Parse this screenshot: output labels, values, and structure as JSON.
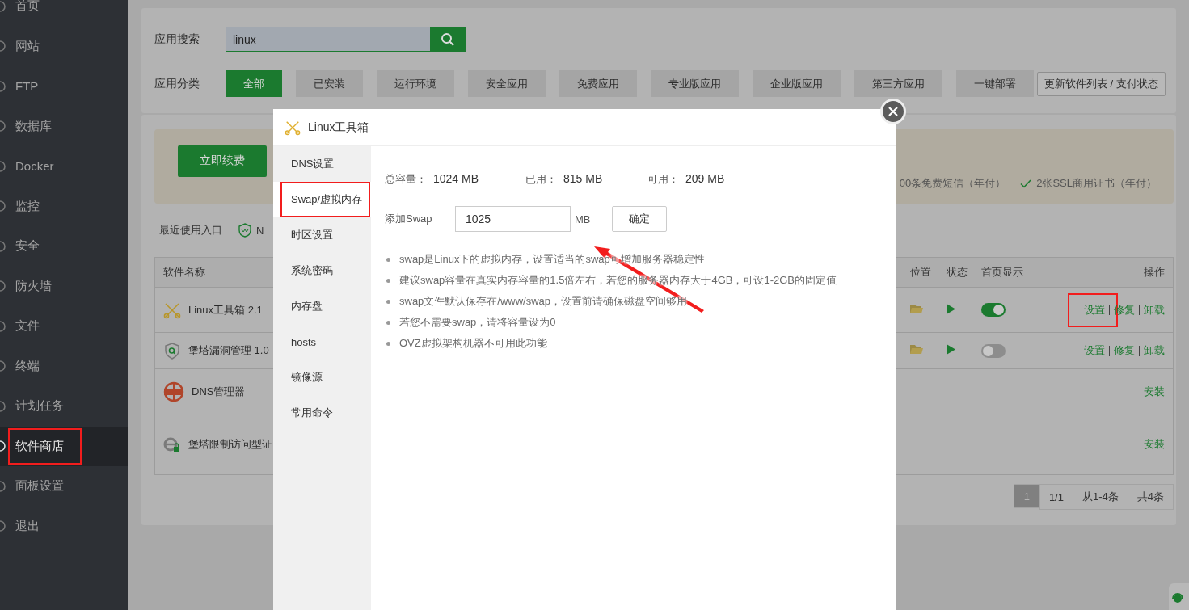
{
  "sidebar": {
    "items": [
      {
        "label": "首页",
        "selected": false,
        "highlighted": false
      },
      {
        "label": "网站",
        "selected": false,
        "highlighted": false
      },
      {
        "label": "FTP",
        "selected": false,
        "highlighted": false
      },
      {
        "label": "数据库",
        "selected": false,
        "highlighted": false
      },
      {
        "label": "Docker",
        "selected": false,
        "highlighted": false
      },
      {
        "label": "监控",
        "selected": false,
        "highlighted": false
      },
      {
        "label": "安全",
        "selected": false,
        "highlighted": false
      },
      {
        "label": "防火墙",
        "selected": false,
        "highlighted": false
      },
      {
        "label": "文件",
        "selected": false,
        "highlighted": false
      },
      {
        "label": "终端",
        "selected": false,
        "highlighted": false
      },
      {
        "label": "计划任务",
        "selected": false,
        "highlighted": false
      },
      {
        "label": "软件商店",
        "selected": true,
        "highlighted": true
      },
      {
        "label": "面板设置",
        "selected": false,
        "highlighted": false
      },
      {
        "label": "退出",
        "selected": false,
        "highlighted": false
      }
    ]
  },
  "search": {
    "label": "应用搜索",
    "value": "linux"
  },
  "categories": {
    "label": "应用分类",
    "items": [
      {
        "label": "全部",
        "selected": true
      },
      {
        "label": "已安装",
        "selected": false
      },
      {
        "label": "运行环境",
        "selected": false
      },
      {
        "label": "安全应用",
        "selected": false
      },
      {
        "label": "免费应用",
        "selected": false
      },
      {
        "label": "专业版应用",
        "selected": false
      },
      {
        "label": "企业版应用",
        "selected": false
      },
      {
        "label": "第三方应用",
        "selected": false
      },
      {
        "label": "一键部署",
        "selected": false
      }
    ],
    "refresh_button": "更新软件列表 / 支付状态"
  },
  "banner": {
    "renew_button": "立即续费",
    "benefit_partial": "00条免费短信（年付）",
    "benefits": [
      "2张SSL商用证书（年付）"
    ]
  },
  "recent": {
    "label": "最近使用入口",
    "items": [
      "N"
    ]
  },
  "table": {
    "columns": [
      "软件名称",
      "位置",
      "状态",
      "首页显示",
      "操作"
    ],
    "rows": [
      {
        "kind": "tools",
        "name": "Linux工具箱 2.1",
        "installed": true,
        "home_display": true,
        "actions": [
          {
            "label": "设置",
            "highlighted": true
          },
          {
            "label": "修复",
            "highlighted": false
          },
          {
            "label": "卸载",
            "highlighted": false
          }
        ]
      },
      {
        "kind": "shield",
        "name": "堡塔漏洞管理 1.0",
        "installed": true,
        "home_display": false,
        "actions": [
          {
            "label": "设置",
            "highlighted": false
          },
          {
            "label": "修复",
            "highlighted": false
          },
          {
            "label": "卸载",
            "highlighted": false
          }
        ]
      },
      {
        "kind": "globe",
        "name": "DNS管理器",
        "installed": false,
        "actions": [
          {
            "label": "安装",
            "highlighted": false
          }
        ]
      },
      {
        "kind": "browser",
        "name": "堡塔限制访问型证",
        "installed": false,
        "actions": [
          {
            "label": "安装",
            "highlighted": false
          }
        ]
      }
    ]
  },
  "pagination": {
    "pages": [
      {
        "label": "1",
        "selected": true
      }
    ],
    "info": [
      "1/1",
      "从1-4条",
      "共4条"
    ]
  },
  "dialog": {
    "title": "Linux工具箱",
    "tabs": [
      {
        "label": "DNS设置",
        "selected": false,
        "highlighted": false
      },
      {
        "label": "Swap/虚拟内存",
        "selected": true,
        "highlighted": true
      },
      {
        "label": "时区设置",
        "selected": false,
        "highlighted": false
      },
      {
        "label": "系统密码",
        "selected": false,
        "highlighted": false
      },
      {
        "label": "内存盘",
        "selected": false,
        "highlighted": false
      },
      {
        "label": "hosts",
        "selected": false,
        "highlighted": false
      },
      {
        "label": "镜像源",
        "selected": false,
        "highlighted": false
      },
      {
        "label": "常用命令",
        "selected": false,
        "highlighted": false
      }
    ],
    "stats": [
      {
        "label": "总容量：",
        "value": "1024 MB"
      },
      {
        "label": "已用：",
        "value": "815 MB"
      },
      {
        "label": "可用：",
        "value": "209 MB"
      }
    ],
    "swap": {
      "label": "添加Swap",
      "value": "1025",
      "unit": "MB",
      "button": "确定"
    },
    "notes": [
      "swap是Linux下的虚拟内存，设置适当的swap可增加服务器稳定性",
      "建议swap容量在真实内存容量的1.5倍左右，若您的服务器内存大于4GB，可设1-2GB的固定值",
      "swap文件默认保存在/www/swap，设置前请确保磁盘空间够用",
      "若您不需要swap，请将容量设为0",
      "OVZ虚拟架构机器不可用此功能"
    ]
  }
}
